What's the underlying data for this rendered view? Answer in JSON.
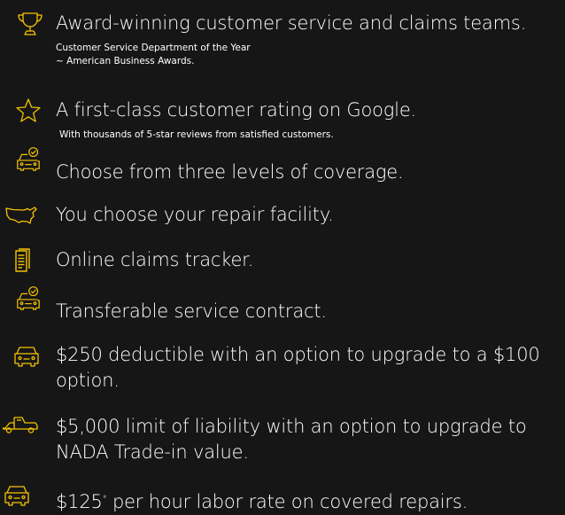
{
  "accent_color": "#f5c400",
  "background_color": "#161616",
  "features": [
    {
      "icon": "trophy-icon",
      "title": "Award-winning customer service and claims teams.",
      "sub_lines": [
        "Customer Service Department of the Year",
        "~ American Business Awards."
      ]
    },
    {
      "icon": "star-icon",
      "title": "A first-class customer rating on Google.",
      "sub_lines": [
        "With thousands of 5-star reviews from satisfied customers."
      ]
    },
    {
      "icon": "car-check-icon",
      "title": "Choose from three levels of coverage."
    },
    {
      "icon": "usa-map-icon",
      "title": "You choose your repair facility."
    },
    {
      "icon": "document-icon",
      "title": "Online claims tracker."
    },
    {
      "icon": "car-check-icon",
      "title": "Transferable service contract."
    },
    {
      "icon": "car-front-icon",
      "title": "$250 deductible with an option to upgrade to a $100 option."
    },
    {
      "icon": "tow-truck-icon",
      "title": "$5,000 limit of liability with an option to upgrade to NADA Trade-in value."
    },
    {
      "icon": "car-front-icon",
      "title_main": "$125",
      "title_sup": "*",
      "title_rest": " per hour labor rate on covered repairs."
    }
  ]
}
